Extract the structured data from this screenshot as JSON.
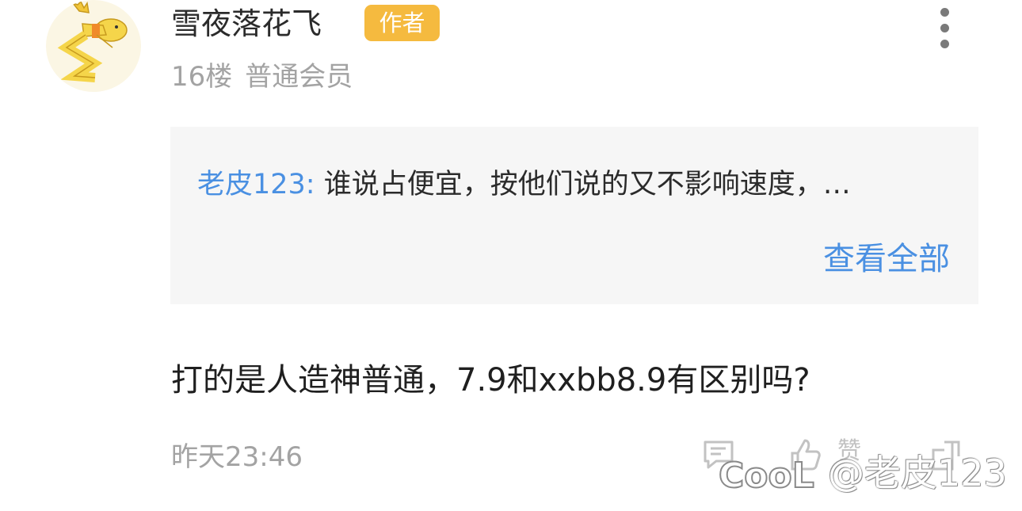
{
  "post": {
    "username": "雪夜落花飞",
    "author_badge": "作者",
    "floor": "16楼",
    "member_level": "普通会员",
    "quote": {
      "author": "老皮123:",
      "text": "谁说占便宜，按他们说的又不影响速度，…",
      "view_all_label": "查看全部"
    },
    "content": "打的是人造神普通，7.9和xxbb8.9有区别吗?",
    "timestamp": "昨天23:46",
    "like_label": "赞"
  },
  "watermark": {
    "text": "@老皮123"
  },
  "icons": {
    "more": "more-vertical-icon",
    "reply": "reply-icon",
    "like": "thumbs-up-icon",
    "share": "share-icon"
  },
  "colors": {
    "link_blue": "#4a90e2",
    "badge_orange": "#f5ba3f",
    "meta_gray": "#a3a3a3",
    "quote_bg": "#f6f6f6"
  }
}
